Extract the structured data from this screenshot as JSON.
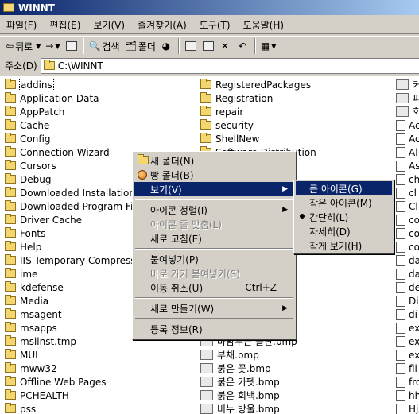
{
  "window": {
    "title": "WINNT"
  },
  "menubar": [
    "파일(F)",
    "편집(E)",
    "보기(V)",
    "즐겨찾기(A)",
    "도구(T)",
    "도움말(H)"
  ],
  "toolbar": {
    "back_label": "뒤로",
    "search_label": "검색",
    "folders_label": "폴더"
  },
  "address": {
    "label": "주소(D)",
    "path": "C:\\WINNT"
  },
  "files": {
    "col1": [
      "addins",
      "Application Data",
      "AppPatch",
      "Cache",
      "Config",
      "Connection Wizard",
      "Cursors",
      "Debug",
      "Downloaded Installations",
      "Downloaded Program File",
      "Driver Cache",
      "Fonts",
      "Help",
      "IIS Temporary Compress",
      "ime",
      "kdefense",
      "Media",
      "msagent",
      "msapps",
      "msiinst.tmp",
      "MUI",
      "mww32",
      "Offline Web Pages",
      "PCHEALTH",
      "pss"
    ],
    "col2_top": [
      "RegisteredPackages",
      "Registration",
      "repair",
      "security",
      "ShellNew"
    ],
    "col2_partial": "Software Distribution",
    "col2_bottom": [
      "바람부는 들판.bmp",
      "부채.bmp",
      "붉은 꽃.bmp",
      "붉은 카펫.bmp",
      "붉은 회백.bmp",
      "비누 방울.bmp"
    ],
    "col3": [
      "커",
      "파",
      "회",
      "Ac",
      "Ac",
      "Al",
      "As",
      "ch",
      "cl",
      "Cl",
      "co",
      "co",
      "co",
      "da",
      "da",
      "de",
      "Di",
      "di",
      "ex",
      "ex",
      "ex",
      "fli",
      "fro",
      "hh",
      "Hj"
    ]
  },
  "context_menu": {
    "items": [
      {
        "label": "새 폴더(N)"
      },
      {
        "label": "빵 폴더(B)"
      },
      {
        "label": "보기(V)"
      },
      {
        "label": "아이콘 정렬(I)"
      },
      {
        "label": "아이콘 줄 맞춤(L)"
      },
      {
        "label": "새로 고침(E)"
      },
      {
        "label": "붙여넣기(P)"
      },
      {
        "label": "바로 가기 붙여넣기(S)"
      },
      {
        "label": "이동 취소(U)",
        "shortcut": "Ctrl+Z"
      },
      {
        "label": "새로 만들기(W)"
      },
      {
        "label": "등록 정보(R)"
      }
    ]
  },
  "view_submenu": {
    "items": [
      "큰 아이콘(G)",
      "작은 아이콘(M)",
      "간단히(L)",
      "자세히(D)",
      "작게 보기(H)"
    ],
    "selected": "간단히(L)"
  },
  "colors": {
    "highlight": "#0a246a",
    "face": "#d4d0c8"
  }
}
